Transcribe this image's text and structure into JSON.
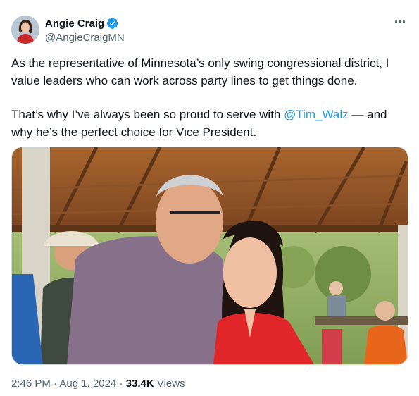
{
  "author": {
    "display_name": "Angie Craig",
    "handle": "@AngieCraigMN",
    "verified": true,
    "avatar_icon": "profile-photo"
  },
  "more_icon": "more-horizontal-icon",
  "tweet": {
    "paragraph1": "As the representative of Minnesota’s only swing congressional district, I value leaders who can work across party lines to get things done.",
    "paragraph2_before": "That’s why I’ve always been so proud to serve with ",
    "mention": "@Tim_Walz",
    "paragraph2_after": " — and why he’s the perfect choice for Vice President."
  },
  "meta": {
    "time": "2:46 PM",
    "separator": "·",
    "date": "Aug 1, 2024",
    "views_count": "33.4K",
    "views_label": "Views"
  },
  "colors": {
    "link": "#1d9bf0",
    "secondary_text": "#536471",
    "verified": "#1d9bf0"
  }
}
